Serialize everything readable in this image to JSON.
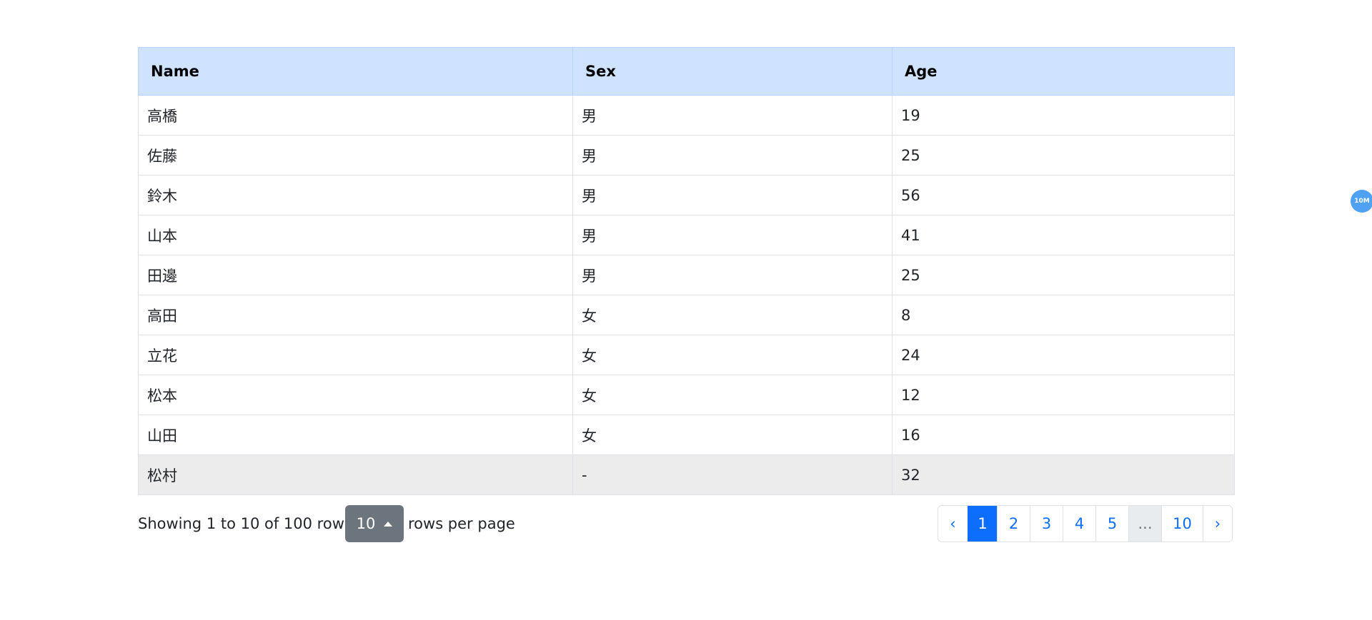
{
  "table": {
    "headers": [
      "Name",
      "Sex",
      "Age"
    ],
    "rows": [
      [
        "高橋",
        "男",
        "19"
      ],
      [
        "佐藤",
        "男",
        "25"
      ],
      [
        "鈴木",
        "男",
        "56"
      ],
      [
        "山本",
        "男",
        "41"
      ],
      [
        "田邊",
        "男",
        "25"
      ],
      [
        "高田",
        "女",
        "8"
      ],
      [
        "立花",
        "女",
        "24"
      ],
      [
        "松本",
        "女",
        "12"
      ],
      [
        "山田",
        "女",
        "16"
      ],
      [
        "松村",
        "-",
        "32"
      ]
    ]
  },
  "footer": {
    "showing_text": "Showing 1 to 10 of 100 rows",
    "page_size": "10",
    "rows_per_page_text": "rows per page"
  },
  "pagination": {
    "prev": "‹",
    "pages": [
      "1",
      "2",
      "3",
      "4",
      "5"
    ],
    "ellipsis": "...",
    "last": "10",
    "next": "›",
    "active_page": "1"
  },
  "badge": {
    "text": "10M"
  },
  "colors": {
    "header_bg": "#cfe2ff",
    "active_page_bg": "#0d6efd",
    "page_size_button_bg": "#6c757d",
    "hovered_row_bg": "#ececec",
    "badge_bg": "#4ea1f3"
  },
  "icons": {
    "page_size_caret": "caret-up-icon"
  }
}
